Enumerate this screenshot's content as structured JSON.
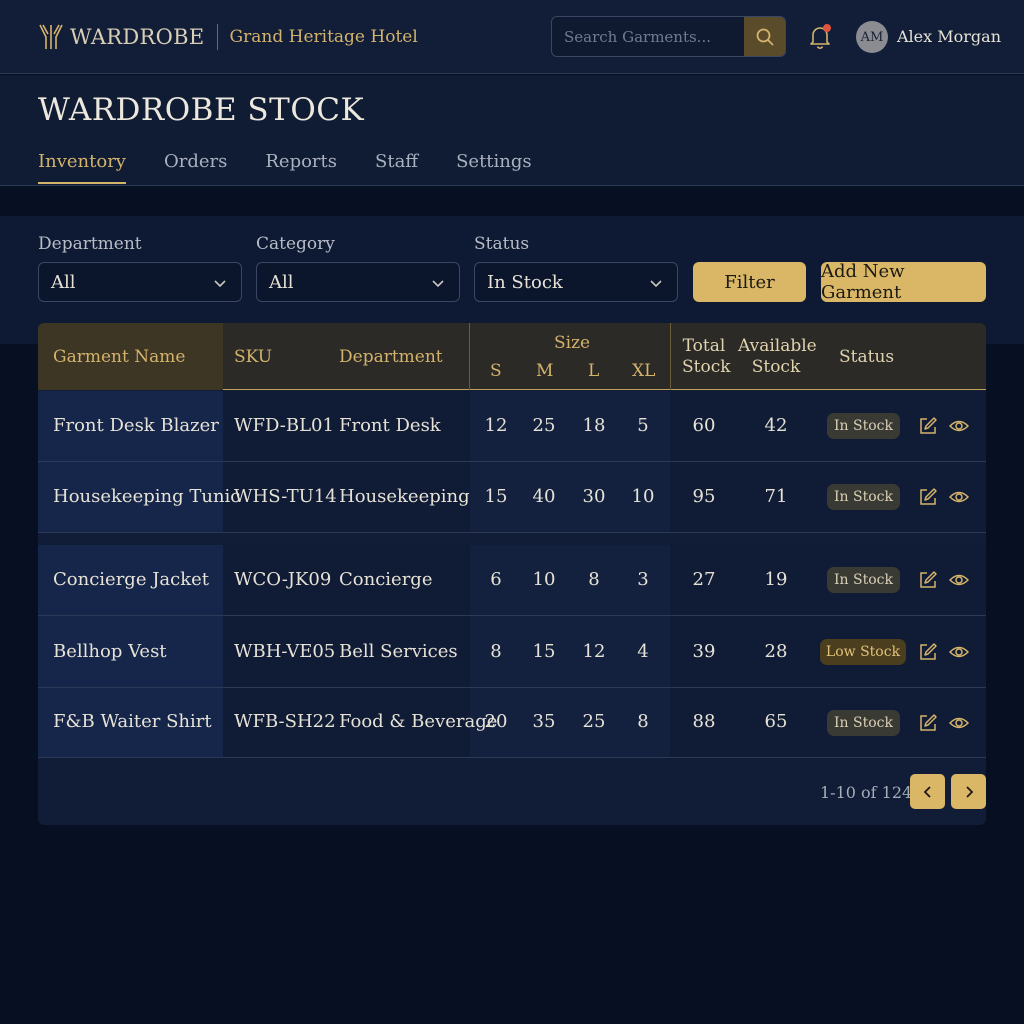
{
  "app": {
    "brand": "WARDROBE",
    "hotel": "Grand Heritage Hotel"
  },
  "search": {
    "placeholder": "Search Garments..."
  },
  "user": {
    "initials": "AM",
    "name": "Alex Morgan"
  },
  "page": {
    "title": "WARDROBE STOCK"
  },
  "tabs": [
    {
      "label": "Inventory",
      "active": true
    },
    {
      "label": "Orders"
    },
    {
      "label": "Reports"
    },
    {
      "label": "Staff"
    },
    {
      "label": "Settings"
    }
  ],
  "filters": {
    "department": {
      "label": "Department",
      "value": "All"
    },
    "category": {
      "label": "Category",
      "value": "All"
    },
    "status": {
      "label": "Status",
      "value": "In Stock"
    },
    "filter_button": "Filter",
    "add_button": "Add New Garment"
  },
  "table": {
    "headers": {
      "name": "Garment Name",
      "sku": "SKU",
      "department": "Department",
      "size": "Size",
      "s": "S",
      "m": "M",
      "l": "L",
      "xl": "XL",
      "total_1": "Total",
      "total_2": "Stock",
      "avail_1": "Available",
      "avail_2": "Stock",
      "status": "Status"
    },
    "rows": [
      {
        "name": "Front Desk Blazer",
        "sku": "WFD-BL01",
        "department": "Front Desk",
        "s": "12",
        "m": "25",
        "l": "18",
        "xl": "5",
        "total": "60",
        "available": "42",
        "status": "In Stock"
      },
      {
        "name": "Housekeeping Tunic",
        "sku": "WHS-TU14",
        "department": "Housekeeping",
        "s": "15",
        "m": "40",
        "l": "30",
        "xl": "10",
        "total": "95",
        "available": "71",
        "status": "In Stock"
      },
      {
        "name": "Concierge Jacket",
        "sku": "WCO-JK09",
        "department": "Concierge",
        "s": "6",
        "m": "10",
        "l": "8",
        "xl": "3",
        "total": "27",
        "available": "19",
        "status": "In Stock"
      },
      {
        "name": "Bellhop Vest",
        "sku": "WBH-VE05",
        "department": "Bell Services",
        "s": "8",
        "m": "15",
        "l": "12",
        "xl": "4",
        "total": "39",
        "available": "28",
        "status": "Low Stock"
      },
      {
        "name": "F&B Waiter Shirt",
        "sku": "WFB-SH22",
        "department": "Food & Beverage",
        "s": "20",
        "m": "35",
        "l": "25",
        "xl": "8",
        "total": "88",
        "available": "65",
        "status": "In Stock"
      }
    ],
    "pagination": "1-10 of 124"
  },
  "colors": {
    "accent": "#d9b767",
    "background": "#070f22",
    "low_stock": "#4a3e1e"
  },
  "icons": [
    "hanger-logo-icon",
    "search-icon",
    "bell-icon",
    "chevron-down-icon",
    "edit-icon",
    "eye-icon",
    "chevron-left-icon",
    "chevron-right-icon"
  ]
}
